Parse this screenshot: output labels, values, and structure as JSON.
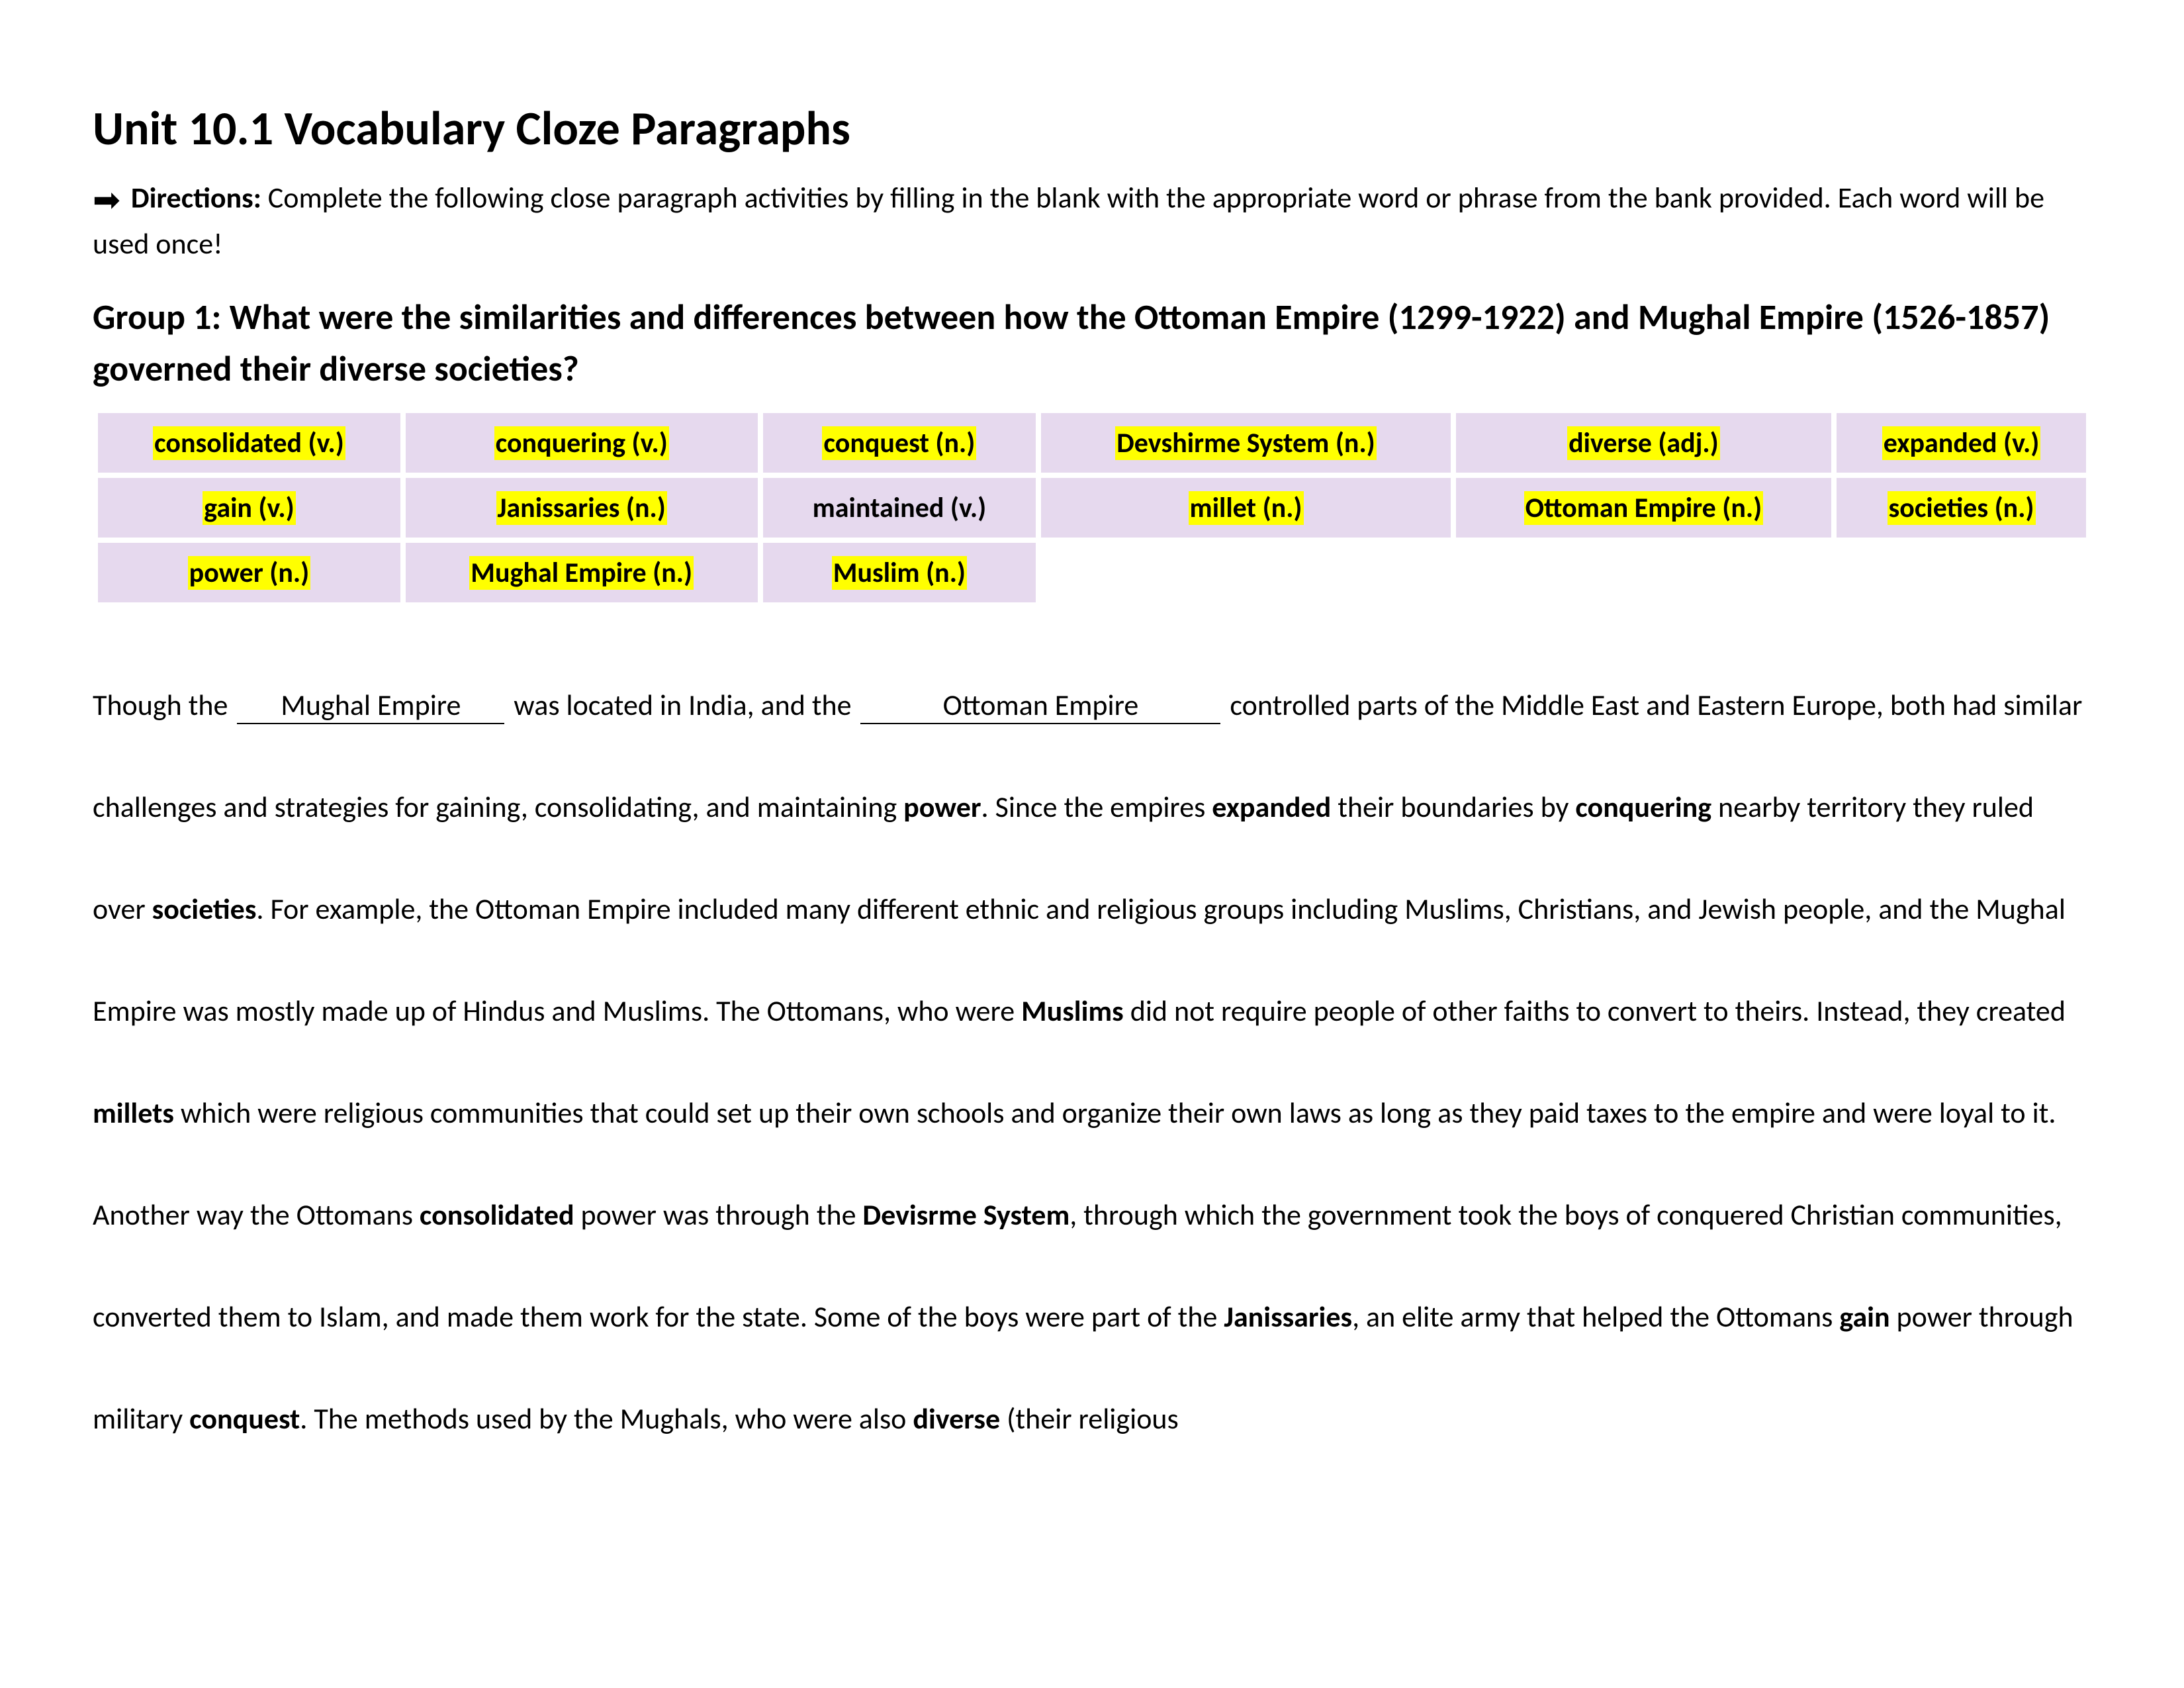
{
  "title": "Unit 10.1 Vocabulary Cloze Paragraphs",
  "directions_label": "Directions:",
  "directions_text": " Complete the following close paragraph activities by filling in the blank with the appropriate word or phrase from the bank provided. Each word will be used once!",
  "group_heading": "Group 1: What were the similarities and differences between how the Ottoman Empire (1299-1922) and Mughal Empire (1526-1857) governed their diverse societies?",
  "bank": {
    "rows": [
      [
        {
          "text": "consolidated (v.)",
          "hl": true
        },
        {
          "text": "conquering (v.)",
          "hl": true
        },
        {
          "text": "conquest (n.)",
          "hl": true
        },
        {
          "text": "Devshirme System (n.)",
          "hl": true
        },
        {
          "text": "diverse (adj.)",
          "hl": true
        },
        {
          "text": "expanded (v.)",
          "hl": true
        }
      ],
      [
        {
          "text": "gain (v.)",
          "hl": true
        },
        {
          "text": "Janissaries (n.)",
          "hl": true
        },
        {
          "text": "maintained (v.)",
          "hl": false
        },
        {
          "text": "millet (n.)",
          "hl": true
        },
        {
          "text": "Ottoman Empire (n.)",
          "hl": true
        },
        {
          "text": "societies (n.)",
          "hl": true
        }
      ],
      [
        {
          "text": "power (n.)",
          "hl": true
        },
        {
          "text": "Mughal Empire (n.)",
          "hl": true
        },
        {
          "text": "Muslim (n.)",
          "hl": true
        },
        {
          "text": "",
          "hl": false,
          "empty": true
        },
        {
          "text": "",
          "hl": false,
          "empty": true
        },
        {
          "text": "",
          "hl": false,
          "empty": true
        }
      ]
    ]
  },
  "para": {
    "t1": "Though the ",
    "blank1": "Mughal Empire",
    "t2": " was located in India, and the ",
    "blank2": "Ottoman Empire",
    "t3": " controlled parts of the Middle East and Eastern Europe, both had similar challenges and strategies for gaining, consolidating, and maintaining ",
    "b1": "power",
    "t4": ". Since the empires ",
    "b2": "expanded",
    "t5": " their boundaries by ",
    "b3": "conquering",
    "t6": " nearby territory they ruled over ",
    "b4": "societies",
    "t7": ". For example, the Ottoman Empire included many different ethnic and religious groups including Muslims, Christians, and Jewish people, and the Mughal Empire was mostly made up of Hindus and Muslims. The Ottomans, who were ",
    "b5": "Muslims",
    "t8": " did not require people of other faiths to convert to theirs. Instead, they created ",
    "b6": "millets",
    "t9": " which were religious communities that could set up their own schools and organize their own laws as long as they paid taxes to the empire and were loyal to it. Another way the Ottomans ",
    "b7": "consolidated",
    "t10": " power was through the ",
    "b8": "Devisrme System",
    "t11": ", through which the government took the boys of conquered Christian communities, converted them to Islam, and made them work for the state. Some of the boys were part of the ",
    "b9": "Janissaries",
    "t12": ", an elite army that helped the Ottomans ",
    "b10": "gain",
    "t13": " power through military ",
    "b11": "conquest",
    "t14": ". The methods used by the Mughals, who were also ",
    "b12": "diverse",
    "t15": " (their religious"
  }
}
